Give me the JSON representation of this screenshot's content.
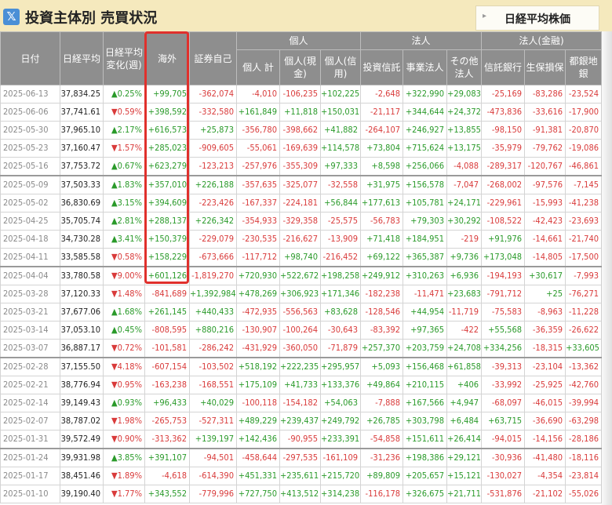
{
  "header": {
    "logo_icon": "x-icon",
    "logo_glyph": "𝕏",
    "title": "投資主体別 売買状況",
    "side_button_label": "日経平均株価",
    "side_arrow_glyph": "▸"
  },
  "columns": {
    "date": "日付",
    "nikkei": "日経平均",
    "change": "日経平均変化(週)",
    "foreign": "海外",
    "proprietary": "証券自己",
    "group_individual": "個人",
    "group_corporate": "法人",
    "group_financial": "法人(金融)",
    "individual_total": "個人 計",
    "individual_cash": "個人(現金)",
    "individual_credit": "個人(信用)",
    "investment_trust": "投資信託",
    "business_corp": "事業法人",
    "other_corp": "その他法人",
    "trust_bank": "信託銀行",
    "life_insurance": "生保損保",
    "city_bank": "都銀地銀"
  },
  "rows": [
    [
      "2025-06-13",
      "37,834.25",
      "▲0.25%",
      "+99,705",
      "-362,074",
      "-4,010",
      "-106,235",
      "+102,225",
      "-2,648",
      "+322,990",
      "+29,083",
      "-25,169",
      "-83,286",
      "-23,524"
    ],
    [
      "2025-06-06",
      "37,741.61",
      "▼0.59%",
      "+398,592",
      "-332,580",
      "+161,849",
      "+11,818",
      "+150,031",
      "-21,117",
      "+344,644",
      "+24,372",
      "-473,836",
      "-33,616",
      "-17,900"
    ],
    [
      "2025-05-30",
      "37,965.10",
      "▲2.17%",
      "+616,573",
      "+25,873",
      "-356,780",
      "-398,662",
      "+41,882",
      "-264,107",
      "+246,927",
      "+13,855",
      "-98,150",
      "-91,381",
      "-20,870"
    ],
    [
      "2025-05-23",
      "37,160.47",
      "▼1.57%",
      "+285,023",
      "-909,605",
      "-55,061",
      "-169,639",
      "+114,578",
      "+73,804",
      "+715,624",
      "+13,175",
      "-35,979",
      "-79,762",
      "-19,086"
    ],
    [
      "2025-05-16",
      "37,753.72",
      "▲0.67%",
      "+623,279",
      "-123,213",
      "-257,976",
      "-355,309",
      "+97,333",
      "+8,598",
      "+256,066",
      "-4,088",
      "-289,317",
      "-120,767",
      "-46,861"
    ],
    [
      "2025-05-09",
      "37,503.33",
      "▲1.83%",
      "+357,010",
      "+226,188",
      "-357,635",
      "-325,077",
      "-32,558",
      "+31,975",
      "+156,578",
      "-7,047",
      "-268,002",
      "-97,576",
      "-7,145"
    ],
    [
      "2025-05-02",
      "36,830.69",
      "▲3.15%",
      "+394,609",
      "-223,426",
      "-167,337",
      "-224,181",
      "+56,844",
      "+177,613",
      "+105,781",
      "+24,171",
      "-229,961",
      "-15,993",
      "-41,238"
    ],
    [
      "2025-04-25",
      "35,705.74",
      "▲2.81%",
      "+288,137",
      "+226,342",
      "-354,933",
      "-329,358",
      "-25,575",
      "-56,783",
      "+79,303",
      "+30,292",
      "-108,522",
      "-42,423",
      "-23,693"
    ],
    [
      "2025-04-18",
      "34,730.28",
      "▲3.41%",
      "+150,379",
      "-229,079",
      "-230,535",
      "-216,627",
      "-13,909",
      "+71,418",
      "+184,951",
      "-219",
      "+91,976",
      "-14,661",
      "-21,740"
    ],
    [
      "2025-04-11",
      "33,585.58",
      "▼0.58%",
      "+158,229",
      "-673,666",
      "-117,712",
      "+98,740",
      "-216,452",
      "+69,122",
      "+365,387",
      "+9,736",
      "+173,048",
      "-14,805",
      "-17,500"
    ],
    [
      "2025-04-04",
      "33,780.58",
      "▼9.00%",
      "+601,126",
      "-1,819,270",
      "+720,930",
      "+522,672",
      "+198,258",
      "+249,912",
      "+310,263",
      "+6,936",
      "-194,193",
      "+30,617",
      "-7,993"
    ],
    [
      "2025-03-28",
      "37,120.33",
      "▼1.48%",
      "-841,689",
      "+1,392,984",
      "+478,269",
      "+306,923",
      "+171,346",
      "-182,238",
      "-11,471",
      "+23,683",
      "-791,712",
      "+25",
      "-76,271"
    ],
    [
      "2025-03-21",
      "37,677.06",
      "▲1.68%",
      "+261,145",
      "+440,433",
      "-472,935",
      "-556,563",
      "+83,628",
      "-128,546",
      "+44,954",
      "-11,719",
      "-75,583",
      "-8,963",
      "-11,228"
    ],
    [
      "2025-03-14",
      "37,053.10",
      "▲0.45%",
      "-808,595",
      "+880,216",
      "-130,907",
      "-100,264",
      "-30,643",
      "-83,392",
      "+97,365",
      "-422",
      "+55,568",
      "-36,359",
      "-26,622"
    ],
    [
      "2025-03-07",
      "36,887.17",
      "▼0.72%",
      "-101,581",
      "-286,242",
      "-431,929",
      "-360,050",
      "-71,879",
      "+257,370",
      "+203,759",
      "+24,708",
      "+334,256",
      "-18,315",
      "+33,605"
    ],
    [
      "2025-02-28",
      "37,155.50",
      "▼4.18%",
      "-607,154",
      "-103,502",
      "+518,192",
      "+222,235",
      "+295,957",
      "+5,093",
      "+156,468",
      "+61,858",
      "-39,313",
      "-23,104",
      "-13,362"
    ],
    [
      "2025-02-21",
      "38,776.94",
      "▼0.95%",
      "-163,238",
      "-168,551",
      "+175,109",
      "+41,733",
      "+133,376",
      "+49,864",
      "+210,115",
      "+406",
      "-33,992",
      "-25,925",
      "-42,760"
    ],
    [
      "2025-02-14",
      "39,149.43",
      "▲0.93%",
      "+96,433",
      "+40,029",
      "-100,118",
      "-154,182",
      "+54,063",
      "-7,888",
      "+167,566",
      "+4,947",
      "-68,097",
      "-46,015",
      "-39,994"
    ],
    [
      "2025-02-07",
      "38,787.02",
      "▼1.98%",
      "-265,753",
      "-527,311",
      "+489,229",
      "+239,437",
      "+249,792",
      "+26,785",
      "+303,798",
      "+6,484",
      "+63,715",
      "-36,690",
      "-63,298"
    ],
    [
      "2025-01-31",
      "39,572.49",
      "▼0.90%",
      "-313,362",
      "+139,197",
      "+142,436",
      "-90,955",
      "+233,391",
      "-54,858",
      "+151,611",
      "+26,414",
      "-94,015",
      "-14,156",
      "-28,186"
    ],
    [
      "2025-01-24",
      "39,931.98",
      "▲3.85%",
      "+391,107",
      "-94,501",
      "-458,644",
      "-297,535",
      "-161,109",
      "-31,236",
      "+198,386",
      "+29,121",
      "-30,936",
      "-41,480",
      "-18,116"
    ],
    [
      "2025-01-17",
      "38,451.46",
      "▼1.89%",
      "-4,618",
      "-614,390",
      "+451,331",
      "+235,611",
      "+215,720",
      "+89,809",
      "+205,657",
      "+15,121",
      "-130,027",
      "-4,354",
      "-23,814"
    ],
    [
      "2025-01-10",
      "39,190.40",
      "▼1.77%",
      "+343,552",
      "-779,996",
      "+727,750",
      "+413,512",
      "+314,238",
      "-116,178",
      "+326,675",
      "+21,711",
      "-531,876",
      "-21,102",
      "-55,026"
    ]
  ],
  "colors": {
    "positive": "#2a9a2a",
    "negative": "#d93b3b",
    "header_bg": "#8e8e8e",
    "highlight": "#e0302c",
    "topbar": "#f5e9bd"
  }
}
